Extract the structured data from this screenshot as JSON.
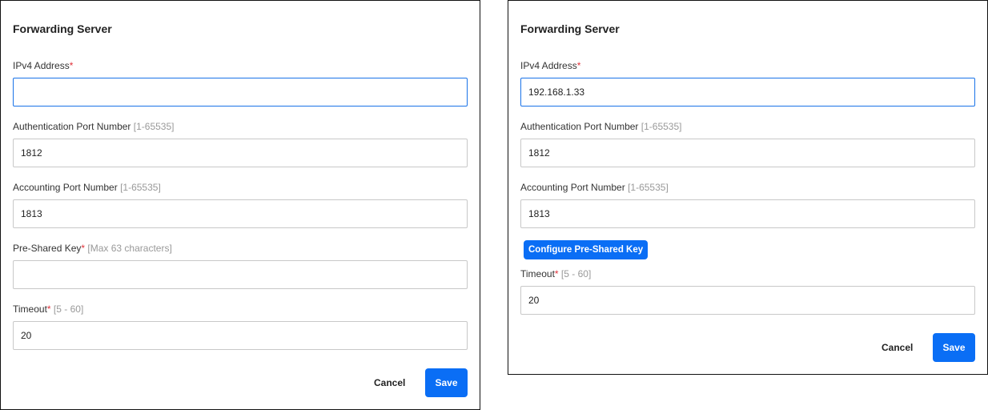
{
  "left_dialog": {
    "title": "Forwarding Server",
    "ipv4": {
      "label": "IPv4 Address",
      "required": "*",
      "value": ""
    },
    "auth_port": {
      "label": "Authentication Port Number",
      "hint": "[1-65535]",
      "value": "1812"
    },
    "acct_port": {
      "label": "Accounting Port Number",
      "hint": "[1-65535]",
      "value": "1813"
    },
    "psk": {
      "label": "Pre-Shared Key",
      "required": "*",
      "hint": "[Max 63 characters]",
      "value": ""
    },
    "timeout": {
      "label": "Timeout",
      "required": "*",
      "hint": "[5 - 60]",
      "value": "20"
    },
    "cancel": "Cancel",
    "save": "Save"
  },
  "right_dialog": {
    "title": "Forwarding Server",
    "ipv4": {
      "label": "IPv4 Address",
      "required": "*",
      "value": "192.168.1.33"
    },
    "auth_port": {
      "label": "Authentication Port Number",
      "hint": "[1-65535]",
      "value": "1812"
    },
    "acct_port": {
      "label": "Accounting Port Number",
      "hint": "[1-65535]",
      "value": "1813"
    },
    "configure_psk": "Configure Pre-Shared Key",
    "timeout": {
      "label": "Timeout",
      "required": "*",
      "hint": "[5 - 60]",
      "value": "20"
    },
    "cancel": "Cancel",
    "save": "Save"
  },
  "colors": {
    "accent": "#0a6ef5",
    "required": "#e0323a",
    "focus": "#1a73e8"
  }
}
